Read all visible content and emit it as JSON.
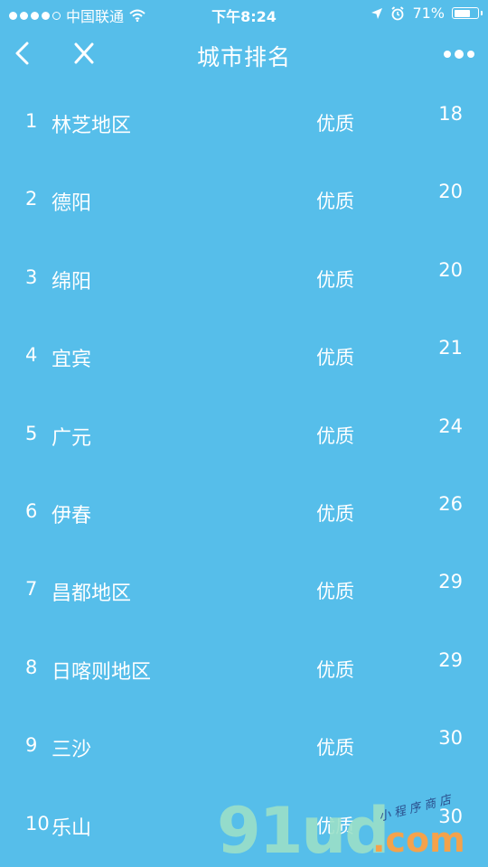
{
  "status_bar": {
    "carrier": "中国联通",
    "time": "下午8:24",
    "battery_percent": "71%",
    "battery_level": 0.71,
    "signal_bars_filled": 4,
    "icons": [
      "signal-dots-icon",
      "wifi-icon",
      "location-arrow-icon",
      "alarm-icon",
      "battery-icon"
    ]
  },
  "nav": {
    "title": "城市排名",
    "icons": [
      "back-chevron-icon",
      "close-x-icon",
      "more-dots-icon"
    ]
  },
  "ranking": [
    {
      "rank": "1",
      "city": "林芝地区",
      "quality": "优质",
      "aqi": "18"
    },
    {
      "rank": "2",
      "city": "德阳",
      "quality": "优质",
      "aqi": "20"
    },
    {
      "rank": "3",
      "city": "绵阳",
      "quality": "优质",
      "aqi": "20"
    },
    {
      "rank": "4",
      "city": "宜宾",
      "quality": "优质",
      "aqi": "21"
    },
    {
      "rank": "5",
      "city": "广元",
      "quality": "优质",
      "aqi": "24"
    },
    {
      "rank": "6",
      "city": "伊春",
      "quality": "优质",
      "aqi": "26"
    },
    {
      "rank": "7",
      "city": "昌都地区",
      "quality": "优质",
      "aqi": "29"
    },
    {
      "rank": "8",
      "city": "日喀则地区",
      "quality": "优质",
      "aqi": "29"
    },
    {
      "rank": "9",
      "city": "三沙",
      "quality": "优质",
      "aqi": "30"
    },
    {
      "rank": "10",
      "city": "乐山",
      "quality": "优质",
      "aqi": "30"
    }
  ],
  "watermark": {
    "logo": "91ud",
    "domain": ".com",
    "tag": "小 程 序 商 店"
  },
  "colors": {
    "background": "#56BEEA",
    "text": "#FFFFFF",
    "watermark_logo": "#9BE0C8",
    "watermark_domain": "#F4A24B"
  }
}
